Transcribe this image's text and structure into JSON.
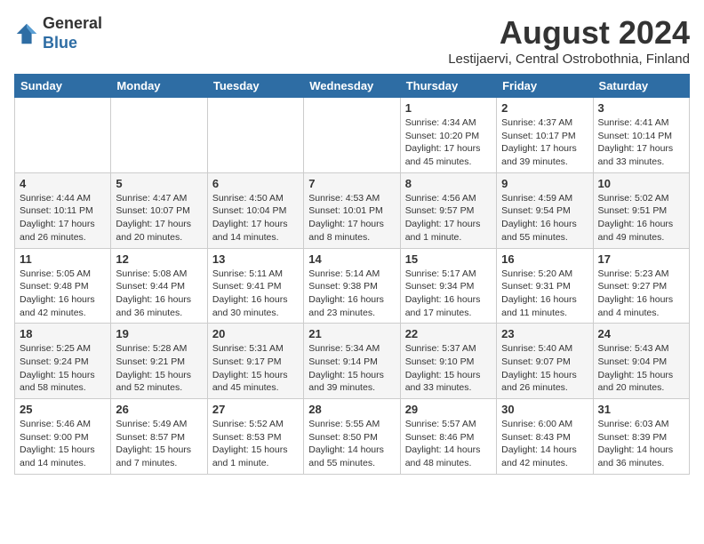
{
  "header": {
    "logo_general": "General",
    "logo_blue": "Blue",
    "month_year": "August 2024",
    "location": "Lestijaervi, Central Ostrobothnia, Finland"
  },
  "calendar": {
    "headers": [
      "Sunday",
      "Monday",
      "Tuesday",
      "Wednesday",
      "Thursday",
      "Friday",
      "Saturday"
    ],
    "rows": [
      [
        {
          "day": "",
          "info": ""
        },
        {
          "day": "",
          "info": ""
        },
        {
          "day": "",
          "info": ""
        },
        {
          "day": "",
          "info": ""
        },
        {
          "day": "1",
          "info": "Sunrise: 4:34 AM\nSunset: 10:20 PM\nDaylight: 17 hours\nand 45 minutes."
        },
        {
          "day": "2",
          "info": "Sunrise: 4:37 AM\nSunset: 10:17 PM\nDaylight: 17 hours\nand 39 minutes."
        },
        {
          "day": "3",
          "info": "Sunrise: 4:41 AM\nSunset: 10:14 PM\nDaylight: 17 hours\nand 33 minutes."
        }
      ],
      [
        {
          "day": "4",
          "info": "Sunrise: 4:44 AM\nSunset: 10:11 PM\nDaylight: 17 hours\nand 26 minutes."
        },
        {
          "day": "5",
          "info": "Sunrise: 4:47 AM\nSunset: 10:07 PM\nDaylight: 17 hours\nand 20 minutes."
        },
        {
          "day": "6",
          "info": "Sunrise: 4:50 AM\nSunset: 10:04 PM\nDaylight: 17 hours\nand 14 minutes."
        },
        {
          "day": "7",
          "info": "Sunrise: 4:53 AM\nSunset: 10:01 PM\nDaylight: 17 hours\nand 8 minutes."
        },
        {
          "day": "8",
          "info": "Sunrise: 4:56 AM\nSunset: 9:57 PM\nDaylight: 17 hours\nand 1 minute."
        },
        {
          "day": "9",
          "info": "Sunrise: 4:59 AM\nSunset: 9:54 PM\nDaylight: 16 hours\nand 55 minutes."
        },
        {
          "day": "10",
          "info": "Sunrise: 5:02 AM\nSunset: 9:51 PM\nDaylight: 16 hours\nand 49 minutes."
        }
      ],
      [
        {
          "day": "11",
          "info": "Sunrise: 5:05 AM\nSunset: 9:48 PM\nDaylight: 16 hours\nand 42 minutes."
        },
        {
          "day": "12",
          "info": "Sunrise: 5:08 AM\nSunset: 9:44 PM\nDaylight: 16 hours\nand 36 minutes."
        },
        {
          "day": "13",
          "info": "Sunrise: 5:11 AM\nSunset: 9:41 PM\nDaylight: 16 hours\nand 30 minutes."
        },
        {
          "day": "14",
          "info": "Sunrise: 5:14 AM\nSunset: 9:38 PM\nDaylight: 16 hours\nand 23 minutes."
        },
        {
          "day": "15",
          "info": "Sunrise: 5:17 AM\nSunset: 9:34 PM\nDaylight: 16 hours\nand 17 minutes."
        },
        {
          "day": "16",
          "info": "Sunrise: 5:20 AM\nSunset: 9:31 PM\nDaylight: 16 hours\nand 11 minutes."
        },
        {
          "day": "17",
          "info": "Sunrise: 5:23 AM\nSunset: 9:27 PM\nDaylight: 16 hours\nand 4 minutes."
        }
      ],
      [
        {
          "day": "18",
          "info": "Sunrise: 5:25 AM\nSunset: 9:24 PM\nDaylight: 15 hours\nand 58 minutes."
        },
        {
          "day": "19",
          "info": "Sunrise: 5:28 AM\nSunset: 9:21 PM\nDaylight: 15 hours\nand 52 minutes."
        },
        {
          "day": "20",
          "info": "Sunrise: 5:31 AM\nSunset: 9:17 PM\nDaylight: 15 hours\nand 45 minutes."
        },
        {
          "day": "21",
          "info": "Sunrise: 5:34 AM\nSunset: 9:14 PM\nDaylight: 15 hours\nand 39 minutes."
        },
        {
          "day": "22",
          "info": "Sunrise: 5:37 AM\nSunset: 9:10 PM\nDaylight: 15 hours\nand 33 minutes."
        },
        {
          "day": "23",
          "info": "Sunrise: 5:40 AM\nSunset: 9:07 PM\nDaylight: 15 hours\nand 26 minutes."
        },
        {
          "day": "24",
          "info": "Sunrise: 5:43 AM\nSunset: 9:04 PM\nDaylight: 15 hours\nand 20 minutes."
        }
      ],
      [
        {
          "day": "25",
          "info": "Sunrise: 5:46 AM\nSunset: 9:00 PM\nDaylight: 15 hours\nand 14 minutes."
        },
        {
          "day": "26",
          "info": "Sunrise: 5:49 AM\nSunset: 8:57 PM\nDaylight: 15 hours\nand 7 minutes."
        },
        {
          "day": "27",
          "info": "Sunrise: 5:52 AM\nSunset: 8:53 PM\nDaylight: 15 hours\nand 1 minute."
        },
        {
          "day": "28",
          "info": "Sunrise: 5:55 AM\nSunset: 8:50 PM\nDaylight: 14 hours\nand 55 minutes."
        },
        {
          "day": "29",
          "info": "Sunrise: 5:57 AM\nSunset: 8:46 PM\nDaylight: 14 hours\nand 48 minutes."
        },
        {
          "day": "30",
          "info": "Sunrise: 6:00 AM\nSunset: 8:43 PM\nDaylight: 14 hours\nand 42 minutes."
        },
        {
          "day": "31",
          "info": "Sunrise: 6:03 AM\nSunset: 8:39 PM\nDaylight: 14 hours\nand 36 minutes."
        }
      ]
    ]
  }
}
